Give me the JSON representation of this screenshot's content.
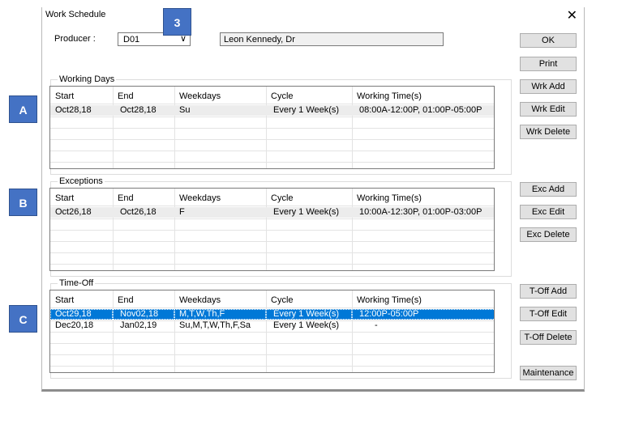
{
  "dialog": {
    "title": "Work Schedule",
    "close": "✕"
  },
  "producer": {
    "label": "Producer :",
    "code": "D01",
    "arrow": "∨",
    "name": "Leon Kennedy, Dr"
  },
  "columns": [
    "Start",
    "End",
    "Weekdays",
    "Cycle",
    "Working Time(s)"
  ],
  "working_days": {
    "title": "Working Days",
    "rows": [
      [
        "Oct28,18",
        "Oct28,18",
        "Su",
        "Every 1 Week(s)",
        "08:00A-12:00P, 01:00P-05:00P"
      ]
    ]
  },
  "exceptions": {
    "title": "Exceptions",
    "rows": [
      [
        "Oct26,18",
        "Oct26,18",
        "F",
        "Every 1 Week(s)",
        "10:00A-12:30P, 01:00P-03:00P"
      ]
    ]
  },
  "time_off": {
    "title": "Time-Off",
    "rows": [
      [
        "Oct29,18",
        "Nov02,18",
        "M,T,W,Th,F",
        "Every 1 Week(s)",
        "12:00P-05:00P"
      ],
      [
        "Dec20,18",
        "Jan02,19",
        "Su,M,T,W,Th,F,Sa",
        "Every 1 Week(s)",
        "-"
      ]
    ]
  },
  "buttons": {
    "ok": "OK",
    "print": "Print",
    "wrk_add": "Wrk Add",
    "wrk_edit": "Wrk Edit",
    "wrk_delete": "Wrk Delete",
    "exc_add": "Exc Add",
    "exc_edit": "Exc Edit",
    "exc_delete": "Exc Delete",
    "toff_add": "T-Off Add",
    "toff_edit": "T-Off Edit",
    "toff_delete": "T-Off Delete",
    "maintenance": "Maintenance"
  },
  "markers": {
    "three": "3",
    "a": "A",
    "b": "B",
    "c": "C"
  },
  "colors": {
    "selection": "#0078d7",
    "marker": "#4472c4"
  }
}
